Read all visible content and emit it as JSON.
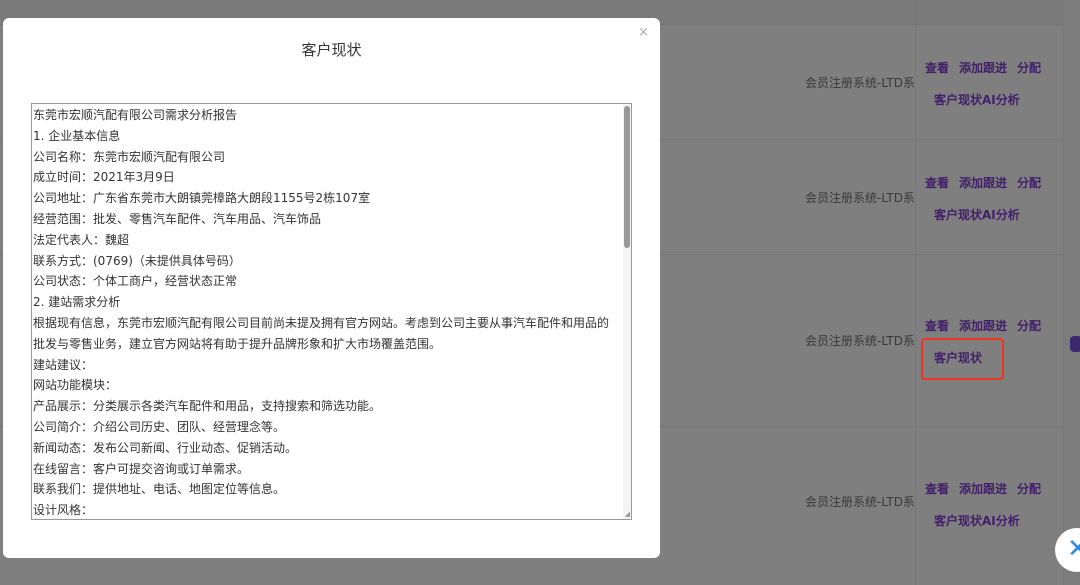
{
  "table": {
    "rows": [
      {
        "system": "会员注册系统-LTD系统",
        "actions": [
          "查看",
          "添加跟进",
          "分配"
        ],
        "extra": "客户现状AI分析"
      },
      {
        "system": "会员注册系统-LTD系统",
        "actions": [
          "查看",
          "添加跟进",
          "分配"
        ],
        "extra": "客户现状AI分析"
      },
      {
        "system": "会员注册系统-LTD系统",
        "actions": [
          "查看",
          "添加跟进",
          "分配"
        ],
        "extra": "客户现状"
      },
      {
        "system": "会员注册系统-LTD系统",
        "actions": [
          "查看",
          "添加跟进",
          "分配"
        ],
        "extra": "客户现状AI分析"
      }
    ]
  },
  "modal": {
    "title": "客户现状",
    "close": "×",
    "lines": [
      "东莞市宏顺汽配有限公司需求分析报告",
      "1. 企业基本信息",
      "公司名称：东莞市宏顺汽配有限公司",
      "成立时间：2021年3月9日",
      "公司地址：广东省东莞市大朗镇莞樟路大朗段1155号2栋107室",
      "经营范围：批发、零售汽车配件、汽车用品、汽车饰品",
      "法定代表人：魏超",
      "联系方式：(0769)（未提供具体号码）",
      "公司状态：个体工商户，经营状态正常",
      "2. 建站需求分析",
      "根据现有信息，东莞市宏顺汽配有限公司目前尚未提及拥有官方网站。考虑到公司主要从事汽车配件和用品的批发与零售业务，建立官方网站将有助于提升品牌形象和扩大市场覆盖范围。",
      "建站建议：",
      "网站功能模块：",
      "产品展示：分类展示各类汽车配件和用品，支持搜索和筛选功能。",
      "公司简介：介绍公司历史、团队、经营理念等。",
      "新闻动态：发布公司新闻、行业动态、促销活动。",
      "在线留言：客户可提交咨询或订单需求。",
      "联系我们：提供地址、电话、地图定位等信息。",
      "设计风格："
    ]
  },
  "colors": {
    "action": "#42206a",
    "highlight": "#f0341e"
  }
}
